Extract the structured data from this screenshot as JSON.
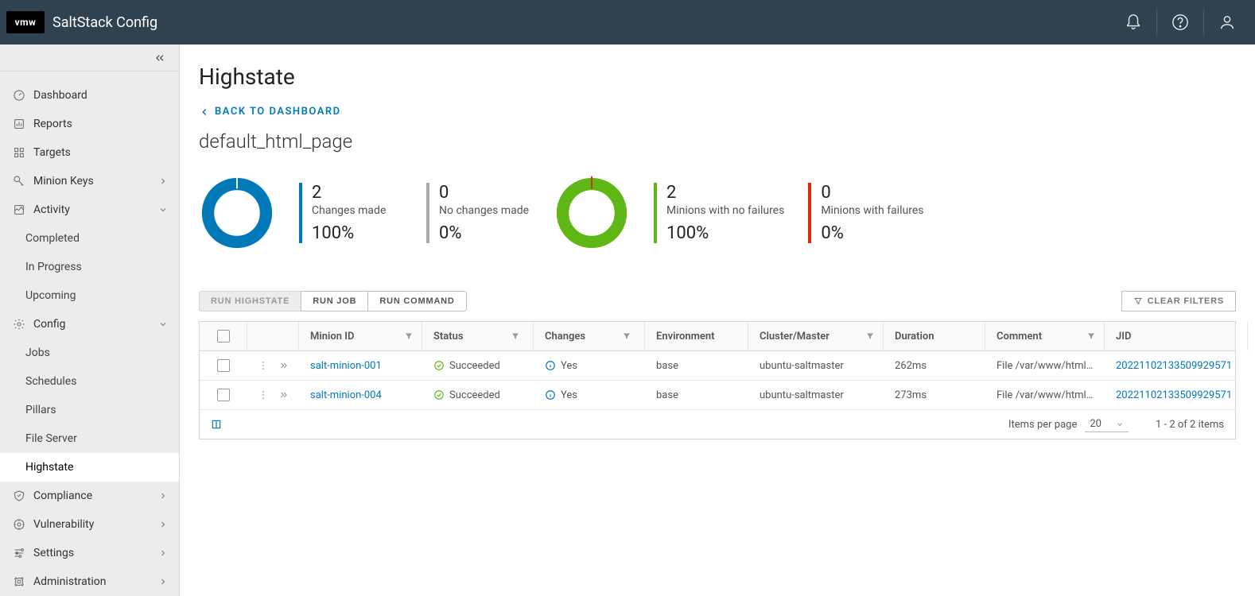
{
  "header": {
    "logo": "vmw",
    "app_title": "SaltStack Config"
  },
  "sidebar": {
    "items": [
      {
        "label": "Dashboard",
        "chev": null
      },
      {
        "label": "Reports",
        "chev": null
      },
      {
        "label": "Targets",
        "chev": null
      },
      {
        "label": "Minion Keys",
        "chev": "right"
      },
      {
        "label": "Activity",
        "chev": "down",
        "children": [
          {
            "label": "Completed"
          },
          {
            "label": "In Progress"
          },
          {
            "label": "Upcoming"
          }
        ]
      },
      {
        "label": "Config",
        "chev": "down",
        "children": [
          {
            "label": "Jobs"
          },
          {
            "label": "Schedules"
          },
          {
            "label": "Pillars"
          },
          {
            "label": "File Server"
          },
          {
            "label": "Highstate",
            "active": true
          }
        ]
      },
      {
        "label": "Compliance",
        "chev": "right"
      },
      {
        "label": "Vulnerability",
        "chev": "right"
      },
      {
        "label": "Settings",
        "chev": "right"
      },
      {
        "label": "Administration",
        "chev": "right"
      }
    ]
  },
  "main": {
    "title": "Highstate",
    "back_label": "BACK TO DASHBOARD",
    "sub_title": "default_html_page",
    "stats": {
      "changes": {
        "value": "2",
        "label": "Changes made",
        "pct": "100%",
        "color": "#0079b8"
      },
      "no_changes": {
        "value": "0",
        "label": "No changes made",
        "pct": "0%",
        "color": "#aaa"
      },
      "minions_ok": {
        "value": "2",
        "label": "Minions with no failures",
        "pct": "100%",
        "color": "#5eb715"
      },
      "minions_fail": {
        "value": "0",
        "label": "Minions with failures",
        "pct": "0%",
        "color": "#e62700"
      }
    },
    "actions": {
      "run_highstate": "RUN HIGHSTATE",
      "run_job": "RUN JOB",
      "run_command": "RUN COMMAND",
      "clear_filters": "CLEAR FILTERS"
    },
    "table": {
      "columns": {
        "minion_id": "Minion ID",
        "status": "Status",
        "changes": "Changes",
        "environment": "Environment",
        "cluster": "Cluster/Master",
        "duration": "Duration",
        "comment": "Comment",
        "jid": "JID"
      },
      "rows": [
        {
          "minion_id": "salt-minion-001",
          "status": "Succeeded",
          "changes": "Yes",
          "environment": "base",
          "cluster": "ubuntu-saltmaster",
          "duration": "262ms",
          "comment": "File /var/www/html...",
          "jid": "20221102133509929571"
        },
        {
          "minion_id": "salt-minion-004",
          "status": "Succeeded",
          "changes": "Yes",
          "environment": "base",
          "cluster": "ubuntu-saltmaster",
          "duration": "273ms",
          "comment": "File /var/www/html...",
          "jid": "20221102133509929571"
        }
      ],
      "footer": {
        "items_per_page_label": "Items per page",
        "items_per_page_value": "20",
        "range": "1 - 2 of 2 items"
      }
    }
  },
  "chart_data": [
    {
      "type": "pie",
      "title": "Changes",
      "series": [
        {
          "name": "Changes made",
          "values": [
            2
          ],
          "color": "#0079b8"
        },
        {
          "name": "No changes made",
          "values": [
            0
          ],
          "color": "#aaa"
        }
      ]
    },
    {
      "type": "pie",
      "title": "Minion failures",
      "series": [
        {
          "name": "Minions with no failures",
          "values": [
            2
          ],
          "color": "#5eb715"
        },
        {
          "name": "Minions with failures",
          "values": [
            0
          ],
          "color": "#e62700"
        }
      ]
    }
  ]
}
